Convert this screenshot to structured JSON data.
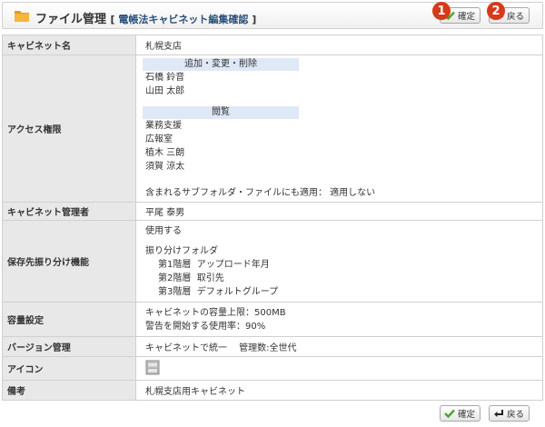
{
  "header": {
    "title": "ファイル管理",
    "subtitle_open": "[",
    "subtitle": "電帳法キャビネット編集確認",
    "subtitle_close": "]",
    "confirm_label": "確定",
    "back_label": "戻る",
    "badge1": "1",
    "badge2": "2"
  },
  "rows": {
    "cabinet_name": {
      "label": "キャビネット名",
      "value": "札幌支店"
    },
    "access": {
      "label": "アクセス権限",
      "group1_title": "追加・変更・削除",
      "group1_users": [
        "石橋 鈴音",
        "山田 太郎"
      ],
      "group2_title": "閲覧",
      "group2_users": [
        "業務支援",
        "広報室",
        "植木 三朗",
        "須賀 涼太"
      ],
      "subfolder_note": "含まれるサブフォルダ・ファイルにも適用： 適用しない"
    },
    "admin": {
      "label": "キャビネット管理者",
      "value": "平尾 泰男"
    },
    "sorting": {
      "label": "保存先振り分け機能",
      "status": "使用する",
      "folder_title": "振り分けフォルダ",
      "levels": [
        "第1階層  アップロード年月",
        "第2階層  取引先",
        "第3階層  デフォルトグループ"
      ]
    },
    "capacity": {
      "label": "容量設定",
      "limit": "キャビネットの容量上限：500MB",
      "warning": "警告を開始する使用率：90%"
    },
    "version": {
      "label": "バージョン管理",
      "value": "キャビネットで統一　 管理数:全世代"
    },
    "icon": {
      "label": "アイコン",
      "icon_name": "cabinet-icon"
    },
    "notes": {
      "label": "備考",
      "value": "札幌支店用キャビネット"
    }
  },
  "footer": {
    "confirm_label": "確定",
    "back_label": "戻る"
  },
  "colors": {
    "badge": "#d63a19",
    "label_bg": "#e8e8e8",
    "group_head_bg": "#dfe8f6",
    "check": "#4aa52e"
  }
}
